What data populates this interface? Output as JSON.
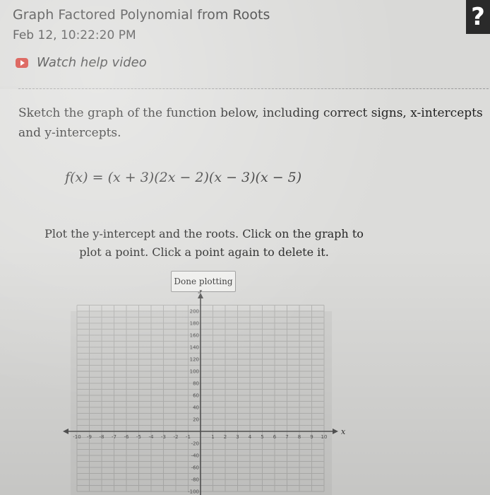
{
  "header": {
    "title": "Graph Factored Polynomial from Roots",
    "timestamp": "Feb 12, 10:22:20 PM",
    "help_video_label": "Watch help video",
    "corner_badge": "?"
  },
  "question": {
    "prompt": "Sketch the graph of the function below, including correct signs, x-intercepts and y-intercepts.",
    "formula": "f(x) = (x + 3)(2x − 2)(x − 3)(x − 5)",
    "instructions": "Plot the y-intercept and the roots. Click on the graph to plot a point. Click a point again to delete it.",
    "done_label": "Done plotting"
  },
  "graph": {
    "x_axis_label": "x",
    "y_axis_label": "y",
    "x_ticks": [
      -10,
      -9,
      -8,
      -7,
      -6,
      -5,
      -4,
      -3,
      -2,
      -1,
      1,
      2,
      3,
      4,
      5,
      6,
      7,
      8,
      9,
      10
    ],
    "y_ticks": [
      200,
      180,
      160,
      140,
      120,
      100,
      80,
      60,
      40,
      20,
      -20,
      -40,
      -60,
      -80,
      -100
    ],
    "x_range": [
      -10,
      10
    ],
    "y_range": [
      -100,
      200
    ]
  }
}
